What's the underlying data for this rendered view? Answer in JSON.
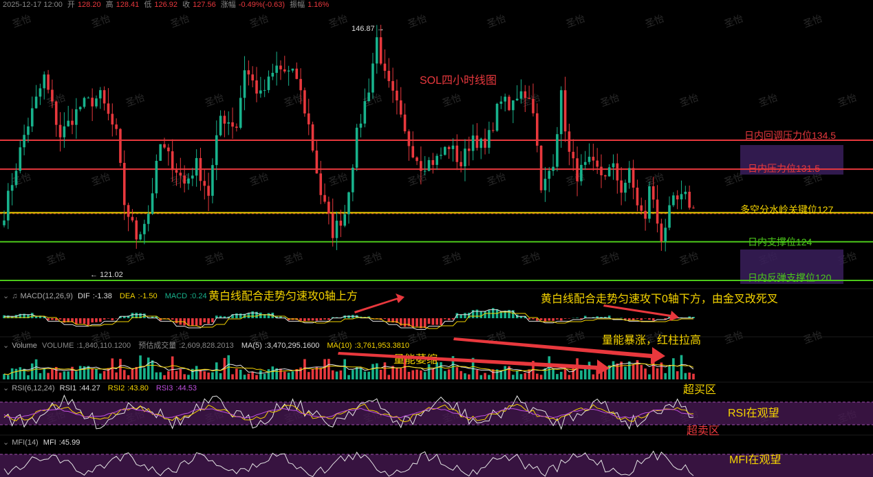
{
  "ohlc_header": {
    "datetime": "2025-12-17 12:00",
    "open_label": "开",
    "open": "128.20",
    "high_label": "高",
    "high": "128.41",
    "low_label": "低",
    "low": "126.92",
    "close_label": "收",
    "close": "127.56",
    "change_label": "涨幅",
    "change": "-0.49%(-0.63)",
    "amplitude_label": "振幅",
    "amplitude": "1.16%"
  },
  "chart_data": {
    "type": "candlestick",
    "title": "SOL四小时线图",
    "high_marker": "146.87",
    "low_marker": "121.02",
    "ylim": [
      119.5,
      149
    ],
    "levels": [
      {
        "label": "日内回调压力位134.5",
        "value": 134.5,
        "color": "#e8383d"
      },
      {
        "label": "日内压力位131.5",
        "value": 131.5,
        "color": "#e8383d"
      },
      {
        "label": "多空分水岭关键位127",
        "value": 127,
        "color": "#f5d400"
      },
      {
        "label": "日内支撑位124",
        "value": 124,
        "color": "#4cc91a"
      },
      {
        "label": "日内反弹支撑位120",
        "value": 120,
        "color": "#4cc91a"
      }
    ],
    "close_anchors": [
      [
        0,
        127
      ],
      [
        5,
        135
      ],
      [
        10,
        141
      ],
      [
        14,
        135
      ],
      [
        19,
        138
      ],
      [
        24,
        139
      ],
      [
        28,
        135
      ],
      [
        30,
        128
      ],
      [
        33,
        124.5
      ],
      [
        36,
        127
      ],
      [
        39,
        134
      ],
      [
        43,
        131.5
      ],
      [
        45,
        130
      ],
      [
        48,
        132
      ],
      [
        51,
        129
      ],
      [
        54,
        137
      ],
      [
        58,
        136
      ],
      [
        60,
        142
      ],
      [
        64,
        139
      ],
      [
        68,
        142
      ],
      [
        73,
        141
      ],
      [
        76,
        136
      ],
      [
        79,
        129
      ],
      [
        82,
        125
      ],
      [
        85,
        127
      ],
      [
        88,
        135
      ],
      [
        91,
        140
      ],
      [
        93,
        145
      ],
      [
        95,
        141
      ],
      [
        98,
        138
      ],
      [
        100,
        135
      ],
      [
        104,
        132
      ],
      [
        108,
        132.5
      ],
      [
        111,
        134
      ],
      [
        114,
        132
      ],
      [
        117,
        135
      ],
      [
        120,
        133.5
      ],
      [
        124,
        139
      ],
      [
        126,
        137.5
      ],
      [
        129,
        140
      ],
      [
        132,
        138
      ],
      [
        134,
        129
      ],
      [
        137,
        132.5
      ],
      [
        139,
        139
      ],
      [
        141,
        133
      ],
      [
        143,
        131
      ],
      [
        146,
        132
      ],
      [
        149,
        131
      ],
      [
        152,
        131.5
      ],
      [
        154,
        129.5
      ],
      [
        156,
        131
      ],
      [
        158,
        128
      ],
      [
        160,
        126
      ],
      [
        161,
        130
      ],
      [
        163,
        126
      ],
      [
        164,
        124.5
      ],
      [
        166,
        127
      ],
      [
        167,
        128
      ],
      [
        170,
        128.5
      ],
      [
        172,
        127.5
      ]
    ],
    "macd": {
      "name": "MACD(12,26,9)",
      "dif_label": "DIF",
      "dif": "-1.38",
      "dea_label": "DEA",
      "dea": "-1.50",
      "macd_label": "MACD",
      "macd": "0.24"
    },
    "volume": {
      "name": "Volume",
      "volume_label": "VOLUME",
      "volume": "1,840,110.1200",
      "est_label": "预估成交量",
      "est": "2,609,828.2013",
      "ma5_label": "MA(5)",
      "ma5": "3,470,295.1600",
      "ma10_label": "MA(10)",
      "ma10": "3,761,953.3810"
    },
    "rsi": {
      "name": "RSI(6,12,24)",
      "rsi1_label": "RSI1",
      "rsi1": "44.27",
      "rsi2_label": "RSI2",
      "rsi2": "43.80",
      "rsi3_label": "RSI3",
      "rsi3": "44.53"
    },
    "mfi": {
      "name": "MFI(14)",
      "mfi_label": "MFI",
      "mfi": "45.99"
    }
  },
  "annotations": {
    "macd_up": "黄白线配合走势匀速攻0轴上方",
    "macd_down": "黄白线配合走势匀速攻下0轴下方，由金叉改死叉",
    "vol_shrink": "量能萎缩",
    "vol_surge": "量能暴涨，红柱拉高",
    "overbought": "超买区",
    "oversold": "超卖区",
    "rsi_watch": "RSI在观望",
    "mfi_watch": "MFI在观望"
  },
  "watermark": "圣怡",
  "colors": {
    "up": "#18b28c",
    "down": "#e8383d",
    "yellow": "#f5d400",
    "white": "#e6e6e6",
    "purple": "#c050e0",
    "green": "#4cc91a"
  }
}
